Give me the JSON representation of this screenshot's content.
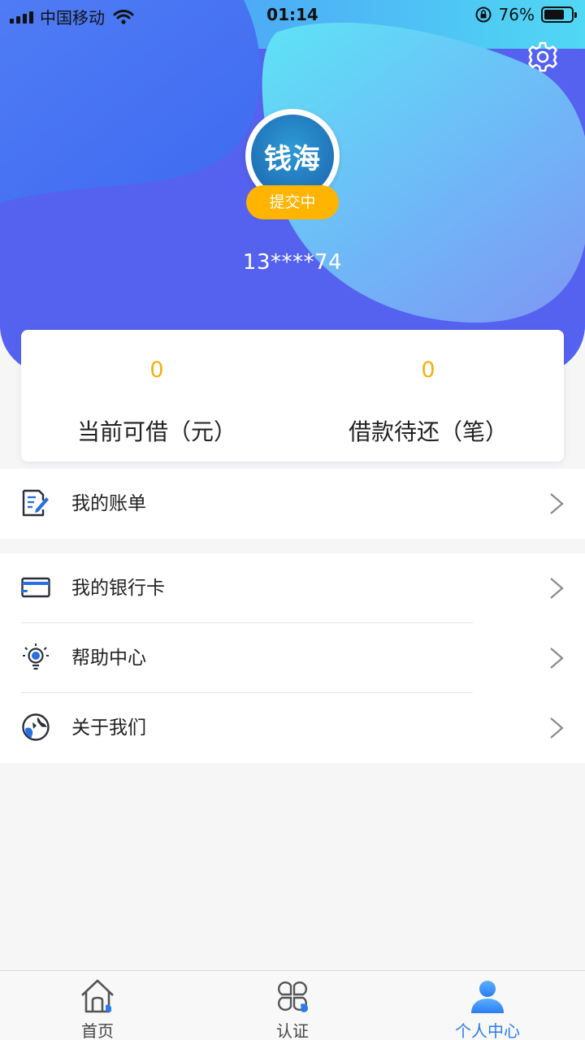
{
  "status_bar": {
    "carrier": "中国移动",
    "time": "01:14",
    "battery_percent": "76%",
    "battery_level": 0.76
  },
  "profile": {
    "avatar_text": "钱海",
    "status_badge": "提交中",
    "phone": "13****74"
  },
  "stats": {
    "available": {
      "value": "0",
      "label": "当前可借（元）"
    },
    "pending": {
      "value": "0",
      "label": "借款待还（笔）"
    }
  },
  "menu": {
    "bill": {
      "label": "我的账单",
      "icon": "document-edit-icon"
    },
    "bank_card": {
      "label": "我的银行卡",
      "icon": "bank-card-icon"
    },
    "help": {
      "label": "帮助中心",
      "icon": "lightbulb-icon"
    },
    "about": {
      "label": "关于我们",
      "icon": "globe-icon"
    }
  },
  "tabs": [
    {
      "label": "首页",
      "icon": "home-icon",
      "active": false
    },
    {
      "label": "认证",
      "icon": "clover-icon",
      "active": false
    },
    {
      "label": "个人中心",
      "icon": "person-icon",
      "active": true
    }
  ],
  "colors": {
    "accent": "#2b7cf0",
    "badge": "#ffb400",
    "stat_number": "#f2b010",
    "header_blue": "#5463f0",
    "header_cyan": "#5ee0f5"
  }
}
